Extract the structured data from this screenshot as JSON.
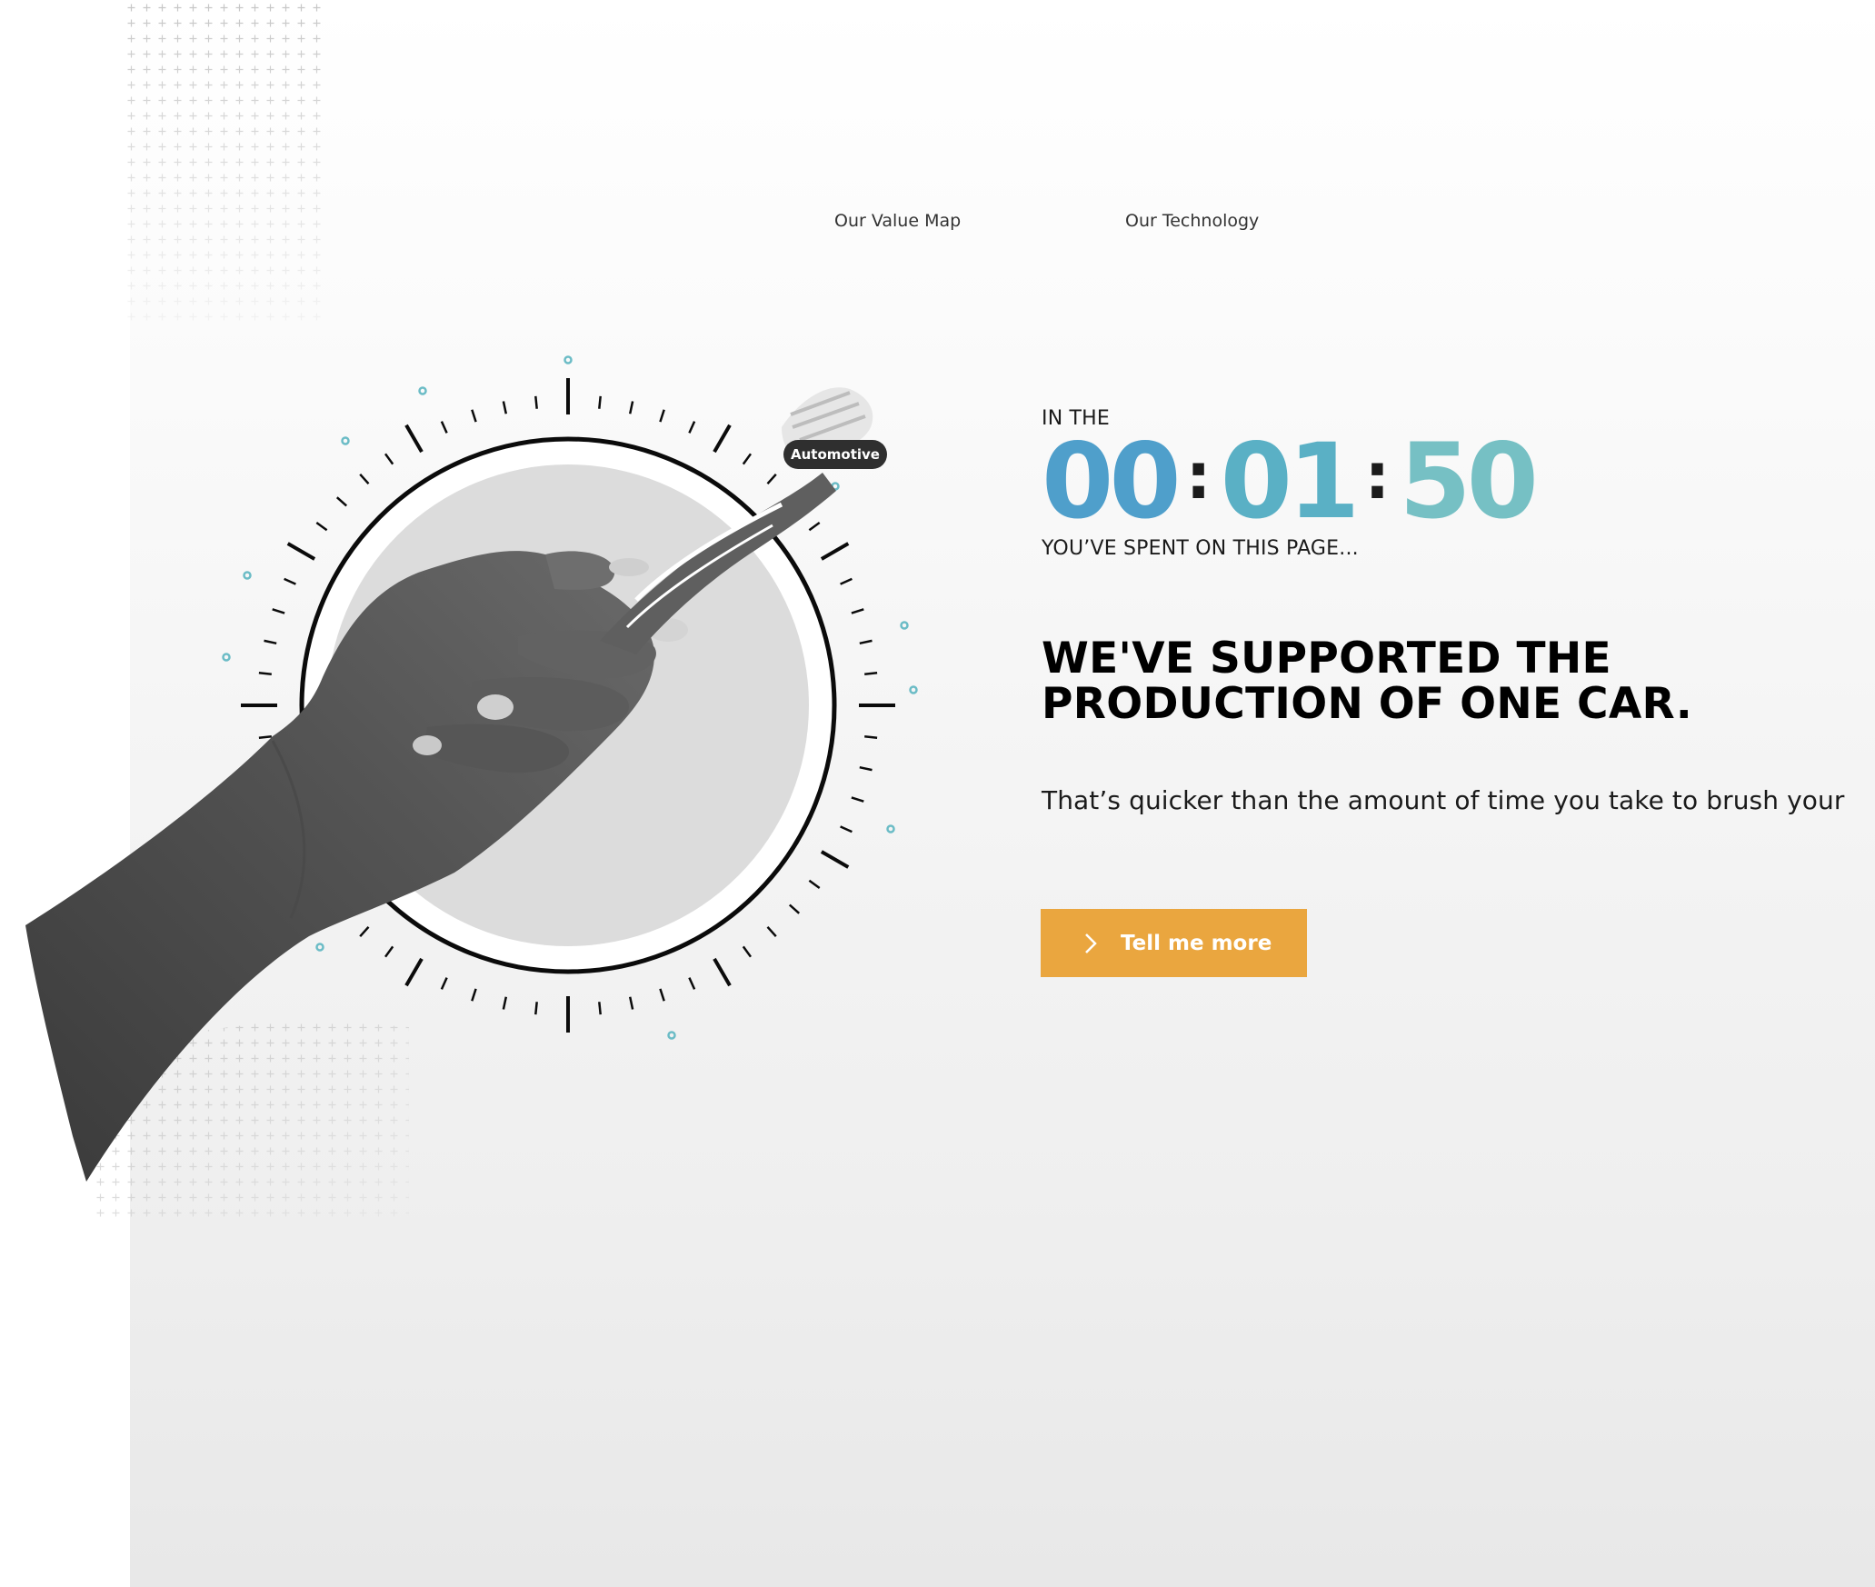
{
  "nav": {
    "links": [
      {
        "label": "Our Value Map"
      },
      {
        "label": "Our Technology"
      }
    ]
  },
  "hero": {
    "tag_label": "Automotive",
    "intro": "IN THE",
    "timer": {
      "hours": "00",
      "minutes": "01",
      "seconds": "50",
      "separator": ":"
    },
    "outro": "YOU’VE SPENT ON THIS PAGE...",
    "headline_line1": "WE'VE SUPPORTED THE",
    "headline_line2": "PRODUCTION OF ONE CAR.",
    "body": "That’s quicker than the amount of time you take to brush your",
    "cta_label": "Tell me more"
  },
  "colors": {
    "accent_button": "#eaa63f",
    "timer_start": "#4f9fcb",
    "timer_end": "#76c0c4",
    "dot_teal": "#6bbcc6"
  }
}
